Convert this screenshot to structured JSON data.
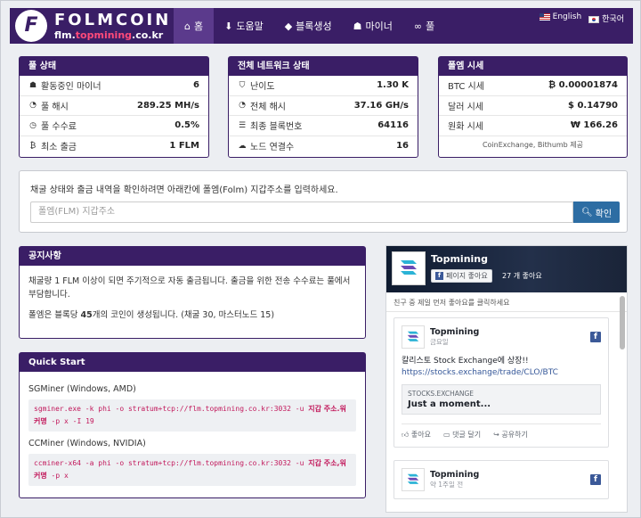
{
  "brand": {
    "name": "FOLMCOIN",
    "sub_pre": "flm.",
    "sub_hl": "topmining",
    "sub_post": ".co.kr"
  },
  "nav": {
    "items": [
      {
        "icon": "home-icon",
        "glyph": "⌂",
        "label": "홈"
      },
      {
        "icon": "download-icon",
        "glyph": "⬇",
        "label": "도움말"
      },
      {
        "icon": "cubes-icon",
        "glyph": "◆",
        "label": "블록생성"
      },
      {
        "icon": "users-icon",
        "glyph": "☗",
        "label": "마이너"
      },
      {
        "icon": "link-icon",
        "glyph": "∞",
        "label": "풀"
      }
    ],
    "lang_en": "English",
    "lang_kr": "한국어"
  },
  "pool_status": {
    "title": "풀 상태",
    "rows": [
      {
        "icon": "users-icon",
        "glyph": "☗",
        "label": "활동중인 마이너",
        "value": "6"
      },
      {
        "icon": "tachometer-icon",
        "glyph": "◔",
        "label": "풀 해시",
        "value": "289.25 MH/s"
      },
      {
        "icon": "clock-icon",
        "glyph": "◷",
        "label": "풀 수수료",
        "value": "0.5%"
      },
      {
        "icon": "bitcoin-icon",
        "glyph": "₿",
        "label": "최소 출금",
        "value": "1 FLM"
      }
    ]
  },
  "network_status": {
    "title": "전체 네트워크 상태",
    "rows": [
      {
        "icon": "shield-icon",
        "glyph": "⛉",
        "label": "난이도",
        "value": "1.30 K"
      },
      {
        "icon": "tachometer-icon",
        "glyph": "◔",
        "label": "전체 해시",
        "value": "37.16 GH/s"
      },
      {
        "icon": "list-icon",
        "glyph": "☰",
        "label": "최종 블록번호",
        "value": "64116"
      },
      {
        "icon": "cloud-icon",
        "glyph": "☁",
        "label": "노드 연결수",
        "value": "16"
      }
    ]
  },
  "market": {
    "title": "폴엠 시세",
    "rows": [
      {
        "label": "BTC 시세",
        "value": "₿ 0.00001874"
      },
      {
        "label": "달러 시세",
        "value": "$ 0.14790"
      },
      {
        "label": "원화 시세",
        "value": "₩ 166.26"
      }
    ],
    "note": "CoinExchange, Bithumb 제공"
  },
  "address": {
    "message": "채굴 상태와 출금 내역을 확인하려면 아래칸에 폴엠(Folm) 지갑주소를 입력하세요.",
    "placeholder": "폴엠(FLM) 지갑주소",
    "button": "확인"
  },
  "notice": {
    "title": "공지사항",
    "p1": "채굴량 1 FLM 이상이 되면 주기적으로 자동 출금됩니다. 출금을 위한 전송 수수료는 풀에서 부담합니다.",
    "p2_pre": "폴엠은 블록당 ",
    "p2_bold": "45",
    "p2_post": "개의 코인이 생성됩니다. (채굴 30, 마스터노드 15)"
  },
  "quickstart": {
    "title": "Quick Start",
    "sg_title": "SGMiner (Windows, AMD)",
    "sg_cmd": "sgminer.exe -k phi -o stratum+tcp://flm.topmining.co.kr:3032 -u ",
    "sg_bold1": "지갑 주소",
    "sg_bold2": ".워커명",
    "sg_tail": " -p x -I 19",
    "cc_title": "CCMiner (Windows, NVIDIA)",
    "cc_cmd": "ccminer-x64 -a phi -o stratum+tcp://flm.topmining.co.kr:3032 -u ",
    "cc_bold1": "지갑 주소",
    "cc_bold2": ",워커명",
    "cc_tail": " -p x"
  },
  "facebook": {
    "page": "Topmining",
    "like_btn": "페이지 좋아요",
    "likes": "27 개 좋아요",
    "hint": "친구 중 제일 먼저 좋아요를 클릭하세요",
    "post1": {
      "name": "Topmining",
      "time": "금요일",
      "text": "칼리스토 Stock Exchange에 상장!!",
      "link": "https://stocks.exchange/trade/CLO/BTC",
      "card_src": "STOCKS.EXCHANGE",
      "card_title": "Just a moment...",
      "like": "좋아요",
      "comment": "댓글 달기",
      "share": "공유하기"
    },
    "post2": {
      "name": "Topmining",
      "time": "약 1주일 전"
    }
  }
}
